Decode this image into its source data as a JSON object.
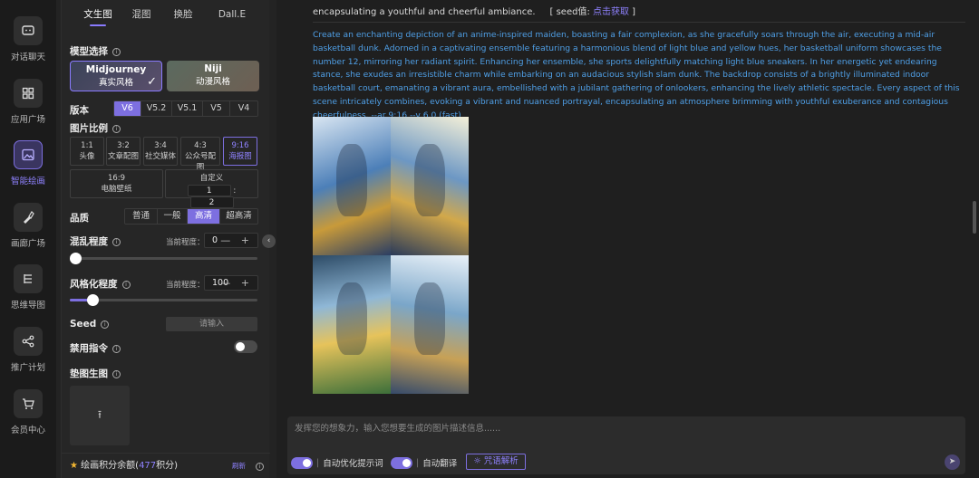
{
  "rail": {
    "items": [
      {
        "label": "对话聊天",
        "icon": "chat-icon"
      },
      {
        "label": "应用广场",
        "icon": "grid-icon"
      },
      {
        "label": "智能绘画",
        "icon": "image-icon"
      },
      {
        "label": "画廊广场",
        "icon": "brush-icon"
      },
      {
        "label": "思维导图",
        "icon": "mindmap-icon"
      },
      {
        "label": "推广计划",
        "icon": "share-icon"
      },
      {
        "label": "会员中心",
        "icon": "cart-icon"
      }
    ]
  },
  "panel": {
    "tabs": [
      "文生图",
      "混图",
      "换脸",
      "Dall.E"
    ],
    "model_title": "模型选择",
    "models": [
      {
        "name": "Midjourney",
        "sub": "真实风格"
      },
      {
        "name": "Niji",
        "sub": "动漫风格"
      }
    ],
    "version_title": "版本",
    "versions": [
      "V6",
      "V5.2",
      "V5.1",
      "V5",
      "V4"
    ],
    "ratio_title": "图片比例",
    "ratios": [
      {
        "r": "1:1",
        "name": "头像"
      },
      {
        "r": "3:2",
        "name": "文章配图"
      },
      {
        "r": "3:4",
        "name": "社交媒体"
      },
      {
        "r": "4:3",
        "name": "公众号配图"
      },
      {
        "r": "9:16",
        "name": "海报图"
      }
    ],
    "wide_ratio": {
      "r": "16:9",
      "name": "电脑壁纸"
    },
    "custom": {
      "label": "自定义",
      "w": "1",
      "sep": ":",
      "h": "2"
    },
    "quality_title": "品质",
    "qualities": [
      "普通",
      "一般",
      "高清",
      "超高清"
    ],
    "chaos_title": "混乱程度",
    "current_label": "当前程度：",
    "chaos_value": "0",
    "stylize_title": "风格化程度",
    "stylize_value": "100",
    "stepper_ctl": "— +",
    "seed_title": "Seed",
    "seed_placeholder": "请输入",
    "ban_title": "禁用指令",
    "pad_title": "垫图生图",
    "upload_icon": "⭱",
    "points_prefix": "绘画积分余额(",
    "points_num": "477",
    "points_suffix": "积分)",
    "refresh": "刷新"
  },
  "main": {
    "line1_text": "encapsulating a youthful and cheerful ambiance.",
    "seed_prefix": "[ seed值: ",
    "seed_link": "点击获取",
    "seed_suffix": " ]",
    "prompt": "Create an enchanting depiction of an anime-inspired maiden, boasting a fair complexion, as she gracefully soars through the air, executing a mid-air basketball dunk. Adorned in a captivating ensemble featuring a harmonious blend of light blue and yellow hues, her basketball uniform showcases the number 12, mirroring her radiant spirit. Enhancing her ensemble, she sports delightfully matching light blue sneakers. In her energetic yet endearing stance, she exudes an irresistible charm while embarking on an audacious stylish slam dunk. The backdrop consists of a brightly illuminated indoor basketball court, emanating a vibrant aura, embellished with a jubilant gathering of onlookers, enhancing the lively athletic spectacle. Every aspect of this scene intricately combines, evoking a vibrant and nuanced portrayal, encapsulating an atmosphere brimming with youthful exuberance and contagious cheerfulness. --ar 9:16 --v 6.0  (fast)",
    "input_placeholder": "发挥您的想象力，输入您想要生成的图片描述信息......",
    "opt1": "自动优化提示词",
    "opt2": "自动翻译",
    "mantra": "咒语解析",
    "colors": {
      "accent": "#7d6fe0",
      "prompt": "#4f9fe6"
    }
  }
}
